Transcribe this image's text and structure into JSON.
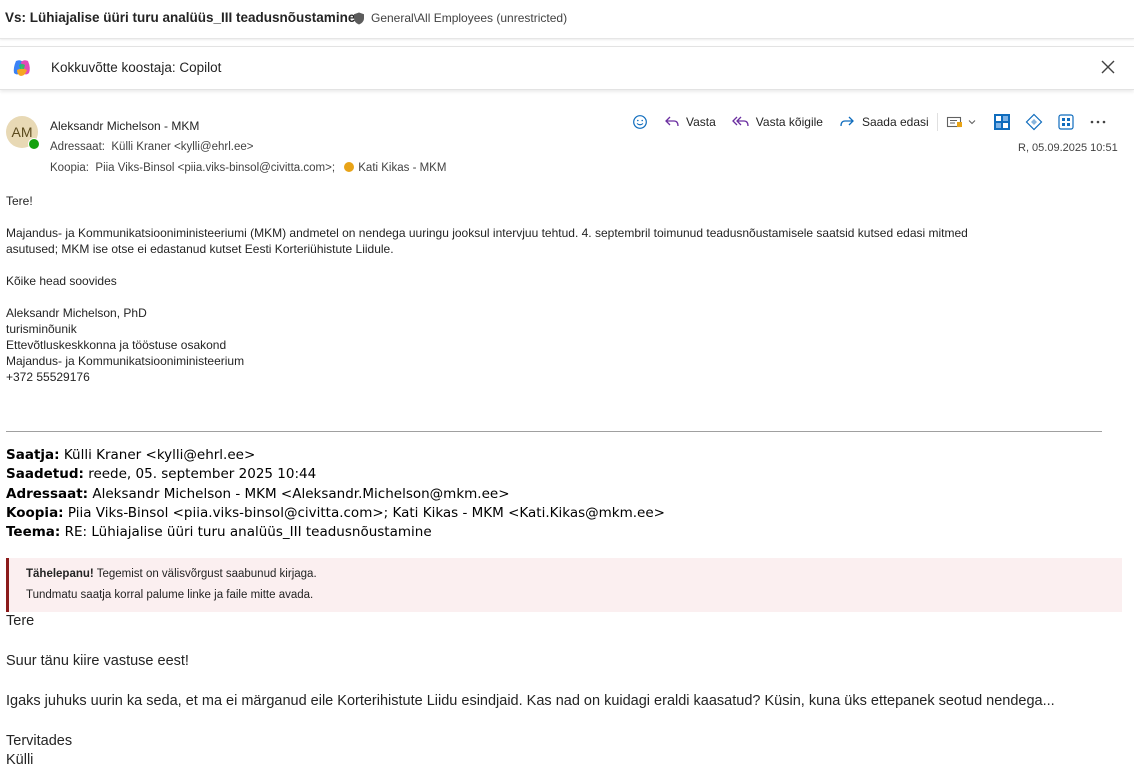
{
  "subject": {
    "title": "Vs: Lühiajalise üüri turu analüüs_III teadusnõustamine",
    "classification": "General\\All Employees (unrestricted)"
  },
  "copilot": {
    "title": "Kokkuvõtte koostaja: Copilot"
  },
  "header": {
    "avatar_initials": "AM",
    "sender": "Aleksandr Michelson - MKM",
    "to_label": "Adressaat:",
    "to_value": "Külli Kraner <kylli@ehrl.ee>",
    "cc_label": "Koopia:",
    "cc_value1": "Piia Viks-Binsol <piia.viks-binsol@civitta.com>;",
    "cc_value2": "Kati Kikas - MKM",
    "timestamp": "R, 05.09.2025 10:51"
  },
  "toolbar": {
    "reply": "Vasta",
    "reply_all": "Vasta kõigile",
    "forward": "Saada edasi"
  },
  "body": {
    "greeting": "Tere!",
    "para1_line1": "Majandus- ja Kommunikatsiooniministeeriumi (MKM) andmetel on nendega uuringu jooksul intervjuu tehtud. 4. septembril toimunud teadusnõustamisele saatsid kutsed edasi mitmed",
    "para1_line2": "asutused; MKM ise otse ei edastanud kutset Eesti Korteriühistute Liidule.",
    "closing": "Kõike head soovides",
    "sig_name": "Aleksandr Michelson, PhD",
    "sig_title": "turisminõunik",
    "sig_dept": "Ettevõtluskeskkonna ja tööstuse osakond",
    "sig_org": "Majandus- ja Kommunikatsiooniministeerium",
    "sig_phone": "+372 55529176"
  },
  "forwarded": {
    "from_label": "Saatja:",
    "from_value": "Külli Kraner <kylli@ehrl.ee>",
    "sent_label": "Saadetud:",
    "sent_value": "reede, 05. september 2025 10:44",
    "to_label": "Adressaat:",
    "to_value": "Aleksandr Michelson - MKM <Aleksandr.Michelson@mkm.ee>",
    "cc_label": "Koopia:",
    "cc_value": "Piia Viks-Binsol <piia.viks-binsol@civitta.com>; Kati Kikas - MKM <Kati.Kikas@mkm.ee>",
    "subject_label": "Teema:",
    "subject_value": "RE: Lühiajalise üüri turu analüüs_III teadusnõustamine"
  },
  "warning": {
    "bold": "Tähelepanu!",
    "line1": "Tegemist on välisvõrgust saabunud kirjaga.",
    "line2": "Tundmatu saatja korral palume linke ja faile mitte avada."
  },
  "quoted": {
    "greeting": "Tere",
    "thanks": "Suur tänu kiire vastuse eest!",
    "question": "Igaks juhuks uurin ka seda, et ma ei märganud eile Korterihistute Liidu esindjaid. Kas nad on kuidagi eraldi kaasatud? Küsin, kuna üks ettepanek seotud nendega...",
    "closing": "Tervitades",
    "name": "Külli"
  },
  "colors": {
    "accent": "#0f6cbd",
    "warning_border": "#8b1a1a",
    "warning_bg": "#fbeff0"
  }
}
